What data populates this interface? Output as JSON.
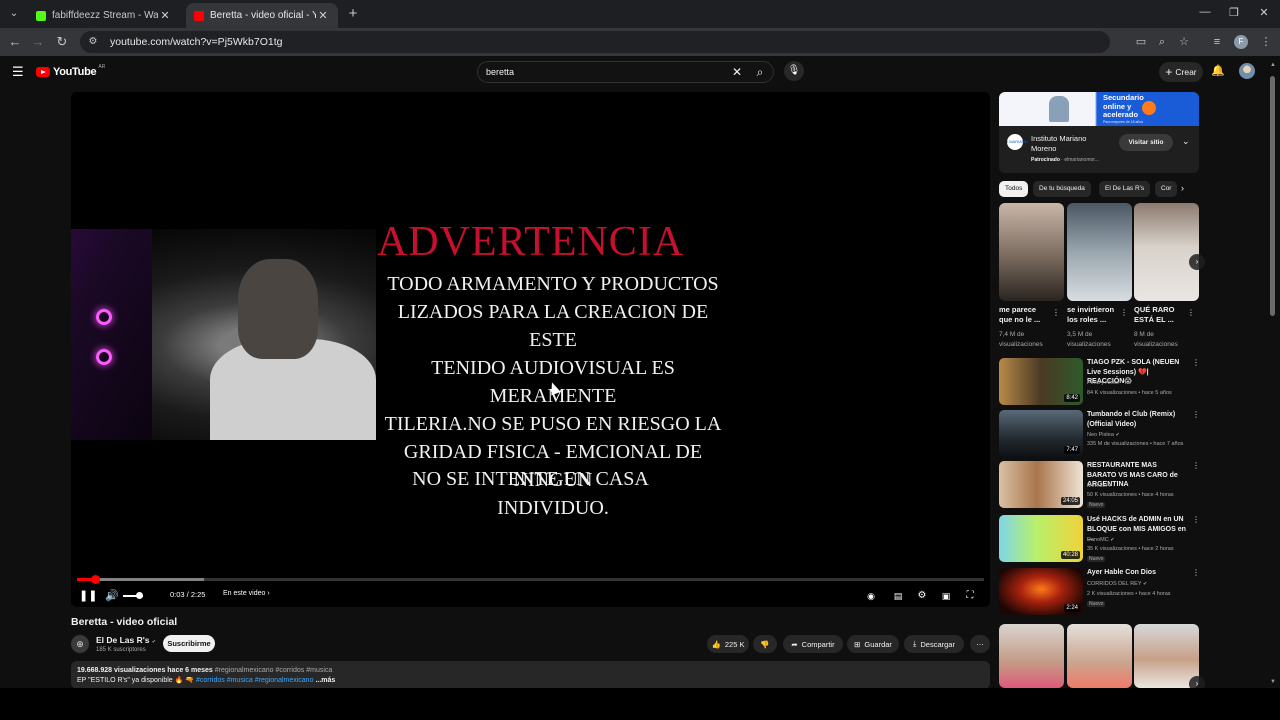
{
  "browser": {
    "tabs": [
      {
        "title": "fabiffdeezz Stream - Watch Live",
        "close": "✕"
      },
      {
        "title": "Beretta - video oficial - YouTube",
        "close": "✕"
      }
    ],
    "new_tab": "+",
    "url": "youtube.com/watch?v=Pj5Wkb7O1tg",
    "profile_initial": "F"
  },
  "masthead": {
    "logo_text": "YouTube",
    "country_code": "AR",
    "search_value": "beretta",
    "create_label": "Crear"
  },
  "player": {
    "warning_title": "ADVERTENCIA",
    "warning_lines": [
      "TODO ARMAMENTO Y PRODUCTOS",
      "LIZADOS PARA LA CREACION DE ESTE",
      "TENIDO AUDIOVISUAL ES MERAMENTE",
      "TILERIA.NO SE PUSO EN RIESGO LA",
      "GRIDAD FISICA - EMCIONAL DE NINGUN",
      "INDIVIDUO."
    ],
    "warning_footer": "NO SE INTENTE EN CASA",
    "time": "0:03 / 2:25",
    "chapter": "En este video",
    "progress_fraction": 0.02,
    "buffered_fraction": 0.14,
    "volume_fraction": 0.8
  },
  "video": {
    "title": "Beretta - video oficial",
    "channel": "El De Las R's",
    "subscribers": "185 K suscriptores",
    "subscribe_label": "Suscribirme",
    "likes": "225 K",
    "share_label": "Compartir",
    "save_label": "Guardar",
    "download_label": "Descargar",
    "views_date": "19.668.928 visualizaciones  hace 6 meses",
    "hashtags": "#regionalmexicano #corridos #musica",
    "desc_text": "EP \"ESTILO R's\" ya disponible",
    "desc_links": "#corridos #musica #regionalmexicano",
    "more_label": "...más"
  },
  "ad": {
    "banner_text": [
      "Secundario",
      "online y",
      "acelerado"
    ],
    "banner_small": "Para mayores de 18 años",
    "advertiser": "Instituto Mariano Moreno",
    "sponsored": "Patrocinado",
    "domain": "elmarianomor...",
    "cta": "Visitar sitio",
    "logo_text": "I.MARIANO"
  },
  "chips": [
    "Todos",
    "De tu búsqueda",
    "El De Las R's",
    "Cor"
  ],
  "shorts": [
    {
      "title": "me parece que no le ...",
      "views": "7,4 M de visualizaciones"
    },
    {
      "title": "se invirtieron los roles ...",
      "views": "3,5 M de visualizaciones"
    },
    {
      "title": "QUÉ RARO ESTÁ EL ...",
      "views": "8 M de visualizaciones"
    }
  ],
  "recommendations": [
    {
      "title": "TIAGO PZK - SOLA (NEUEN Live Sessions) 💔| REACCIÓN😱",
      "channel": "Perla y Aless",
      "meta": "84 K visualizaciones • hace 5 años",
      "duration": "8:42",
      "badge": ""
    },
    {
      "title": "Tumbando el Club (Remix) (Official Video)",
      "channel": "Neo Pistea",
      "meta": "335 M de visualizaciones • hace 7 años",
      "duration": "7:47",
      "badge": ""
    },
    {
      "title": "RESTAURANTE MAS BARATO VS MAS CARO de ARGENTINA",
      "channel": "Mernuel",
      "meta": "50 K visualizaciones • hace 4 horas",
      "duration": "24:05",
      "badge": "Nuevo"
    },
    {
      "title": "Usé HACKS de ADMIN en UN BLOQUE con MIS AMIGOS en ...",
      "channel": "DanoMC",
      "meta": "35 K visualizaciones • hace 2 horas",
      "duration": "40:28",
      "badge": "Nuevo"
    },
    {
      "title": "Ayer Hable Con Dios",
      "channel": "CORRIDOS DEL REY",
      "meta": "2 K visualizaciones • hace 4 horas",
      "duration": "2:24",
      "badge": "Nuevo"
    }
  ],
  "colors": {
    "accent": "#ff0000",
    "warning_red": "#c8102e",
    "background": "#0f0f0f"
  }
}
